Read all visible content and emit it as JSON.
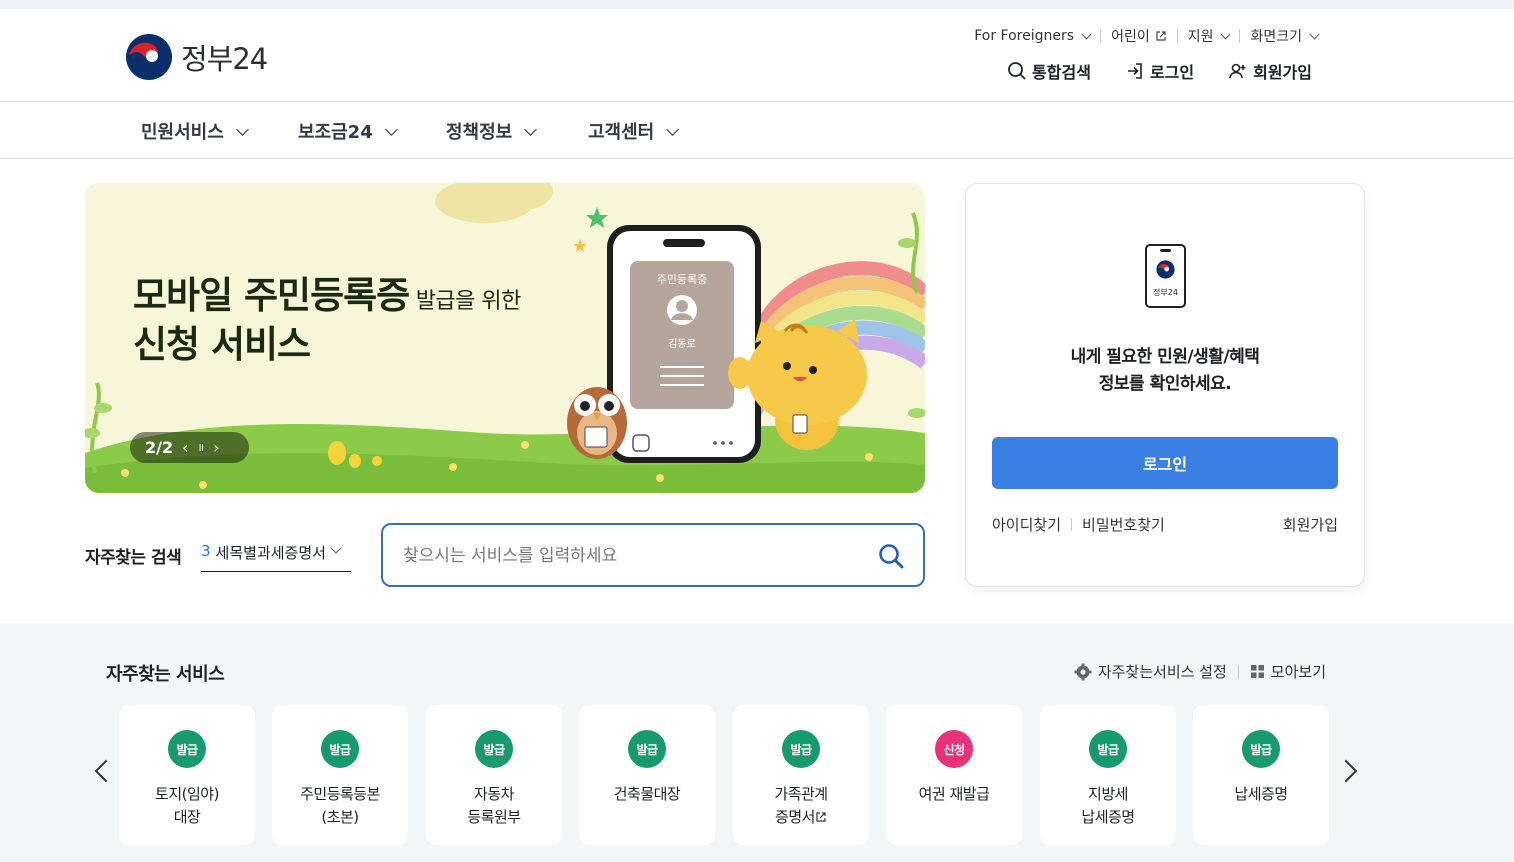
{
  "header": {
    "logo_text": "정부24",
    "util_links": [
      {
        "label": "For Foreigners",
        "icon": "chevron-down-icon"
      },
      {
        "label": "어린이",
        "icon": "external-link-icon"
      },
      {
        "label": "지원",
        "icon": "chevron-down-icon"
      },
      {
        "label": "화면크기",
        "icon": "chevron-down-icon"
      }
    ],
    "actions": {
      "search_label": "통합검색",
      "login_label": "로그인",
      "signup_label": "회원가입"
    }
  },
  "gnb": {
    "items": [
      {
        "label": "민원서비스"
      },
      {
        "label": "보조금24"
      },
      {
        "label": "정책정보"
      },
      {
        "label": "고객센터"
      }
    ]
  },
  "banner": {
    "title_big": "모바일 주민등록증",
    "title_small": " 발급을 위한",
    "title_line2": "신청 서비스",
    "pager": "2/2",
    "prev_symbol": "‹",
    "pause_symbol": "॥",
    "next_symbol": "›",
    "card_title": "주민등록증",
    "card_name": "김동로"
  },
  "login_card": {
    "phone_label": "정부24",
    "message_line1": "내게 필요한 민원/생활/혜택",
    "message_line2": "정보를 확인하세요.",
    "login_button": "로그인",
    "find_id": "아이디찾기",
    "find_pw": "비밀번호찾기",
    "signup": "회원가입"
  },
  "frequent_search": {
    "label": "자주찾는 검색",
    "rank": "3",
    "keyword": "세목별과세증명서"
  },
  "search": {
    "placeholder": "찾으시는 서비스를 입력하세요"
  },
  "services": {
    "title": "자주찾는 서비스",
    "settings_label": "자주찾는서비스 설정",
    "view_all_label": "모아보기",
    "items": [
      {
        "badge": "발급",
        "line1": "토지(임야)",
        "line2": "대장",
        "color": "#179a6d"
      },
      {
        "badge": "발급",
        "line1": "주민등록등본",
        "line2": "(초본)",
        "color": "#179a6d"
      },
      {
        "badge": "발급",
        "line1": "자동차",
        "line2": "등록원부",
        "color": "#179a6d"
      },
      {
        "badge": "발급",
        "line1": "건축물대장",
        "line2": "",
        "color": "#179a6d"
      },
      {
        "badge": "발급",
        "line1": "가족관계",
        "line2": "증명서",
        "color": "#179a6d"
      },
      {
        "badge": "신청",
        "line1": "여권 재발급",
        "line2": "",
        "color": "#e8337a"
      },
      {
        "badge": "발급",
        "line1": "지방세",
        "line2": "납세증명",
        "color": "#179a6d"
      },
      {
        "badge": "발급",
        "line1": "납세증명",
        "line2": "",
        "color": "#179a6d"
      }
    ]
  }
}
